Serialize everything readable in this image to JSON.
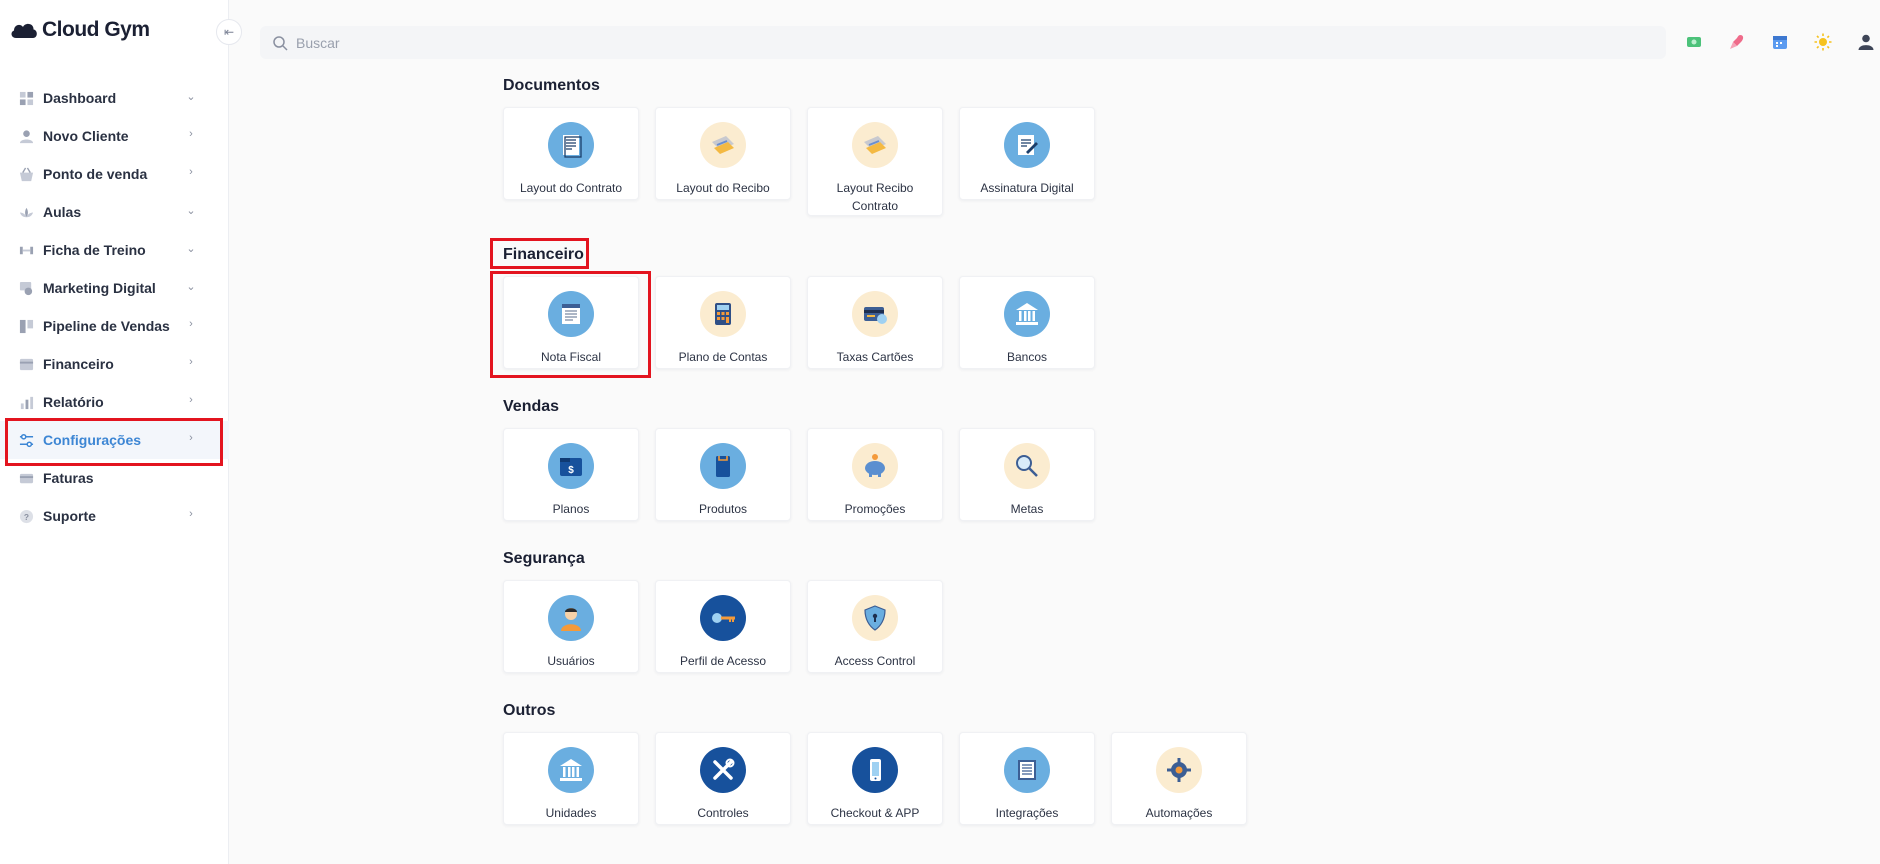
{
  "app": {
    "brand": "Cloud Gym"
  },
  "search": {
    "placeholder": "Buscar"
  },
  "top_icons": [
    "money-icon",
    "rocket-icon",
    "calendar-icon",
    "sun-icon",
    "user-icon"
  ],
  "sidebar": {
    "items": [
      {
        "label": "Dashboard",
        "icon": "dashboard-icon",
        "chevron": "⌄"
      },
      {
        "label": "Novo Cliente",
        "icon": "user-icon",
        "chevron": "›"
      },
      {
        "label": "Ponto de venda",
        "icon": "basket-icon",
        "chevron": "›"
      },
      {
        "label": "Aulas",
        "icon": "lotus-icon",
        "chevron": "⌄"
      },
      {
        "label": "Ficha de Treino",
        "icon": "dumbbell-icon",
        "chevron": "⌄"
      },
      {
        "label": "Marketing Digital",
        "icon": "megaphone-icon",
        "chevron": "⌄"
      },
      {
        "label": "Pipeline de Vendas",
        "icon": "pipeline-icon",
        "chevron": "›"
      },
      {
        "label": "Financeiro",
        "icon": "wallet-icon",
        "chevron": "›"
      },
      {
        "label": "Relatório",
        "icon": "bar-chart-icon",
        "chevron": "›"
      },
      {
        "label": "Configurações",
        "icon": "sliders-icon",
        "chevron": "›",
        "active": true
      },
      {
        "label": "Faturas",
        "icon": "card-icon",
        "chevron": ""
      },
      {
        "label": "Suporte",
        "icon": "help-icon",
        "chevron": "›"
      }
    ]
  },
  "sections": {
    "documentos": {
      "title": "Documentos",
      "cards": [
        {
          "label": "Layout do Contrato",
          "icon": "contract-icon"
        },
        {
          "label": "Layout do Recibo",
          "icon": "receipt-icon"
        },
        {
          "label": "Layout Recibo Contrato",
          "icon": "receipt-icon"
        },
        {
          "label": "Assinatura Digital",
          "icon": "signature-icon"
        }
      ]
    },
    "financeiro": {
      "title": "Financeiro",
      "cards": [
        {
          "label": "Nota Fiscal",
          "icon": "invoice-icon"
        },
        {
          "label": "Plano de Contas",
          "icon": "calculator-icon"
        },
        {
          "label": "Taxas Cartões",
          "icon": "credit-card-icon"
        },
        {
          "label": "Bancos",
          "icon": "bank-icon"
        }
      ]
    },
    "vendas": {
      "title": "Vendas",
      "cards": [
        {
          "label": "Planos",
          "icon": "price-folder-icon"
        },
        {
          "label": "Produtos",
          "icon": "product-icon"
        },
        {
          "label": "Promoções",
          "icon": "piggy-bank-icon"
        },
        {
          "label": "Metas",
          "icon": "magnifier-icon"
        }
      ]
    },
    "seguranca": {
      "title": "Segurança",
      "cards": [
        {
          "label": "Usuários",
          "icon": "person-icon"
        },
        {
          "label": "Perfil de Acesso",
          "icon": "key-icon"
        },
        {
          "label": "Access Control",
          "icon": "shield-icon"
        }
      ]
    },
    "outros": {
      "title": "Outros",
      "cards": [
        {
          "label": "Unidades",
          "icon": "building-icon"
        },
        {
          "label": "Controles",
          "icon": "tools-icon"
        },
        {
          "label": "Checkout & APP",
          "icon": "phone-icon"
        },
        {
          "label": "Integrações",
          "icon": "integration-icon"
        },
        {
          "label": "Automações",
          "icon": "gear-icon"
        }
      ]
    }
  },
  "colors": {
    "accent": "#3d86d4",
    "highlight": "#e3141f",
    "icon_blue": "#6aaee0",
    "icon_dark": "#17519c",
    "icon_beige": "#fbecd0"
  }
}
